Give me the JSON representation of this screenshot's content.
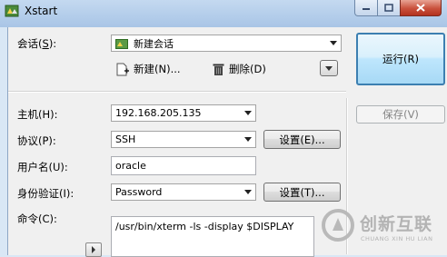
{
  "window": {
    "title": "Xstart"
  },
  "session": {
    "label": "会话(S):",
    "label_prefix": "会话(",
    "label_key": "S",
    "label_suffix": "):",
    "selected": "新建会话",
    "new_label": "新建(N)...",
    "delete_label": "删除(D)"
  },
  "run_button": "运行(R)",
  "save_button": "保存(V)",
  "host": {
    "label": "主机(H):",
    "value": "192.168.205.135"
  },
  "protocol": {
    "label": "协议(P):",
    "value": "SSH",
    "settings": "设置(E)..."
  },
  "username": {
    "label": "用户名(U):",
    "value": "oracle"
  },
  "auth": {
    "label": "身份验证(I):",
    "value": "Password",
    "settings": "设置(T)..."
  },
  "command": {
    "label": "命令(C):",
    "value": "/usr/bin/xterm -ls -display $DISPLAY"
  },
  "watermark": {
    "brand": "创新互联",
    "sub": "CHUANG XIN HU LIAN"
  },
  "colors": {
    "accent": "#3c7fb1",
    "titlebar": "#b3cdea",
    "close": "#c9513c"
  }
}
